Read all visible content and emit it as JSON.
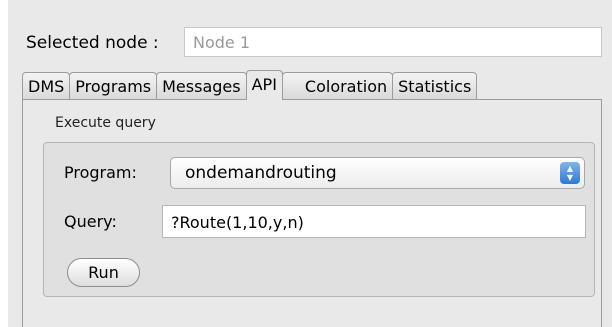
{
  "header": {
    "selected_node_label": "Selected node :",
    "selected_node_value": "Node 1"
  },
  "tabs": [
    {
      "label": "DMS",
      "active": false
    },
    {
      "label": "Programs",
      "active": false
    },
    {
      "label": "Messages",
      "active": false
    },
    {
      "label": "API",
      "active": true
    },
    {
      "label": "Coloration",
      "active": false
    },
    {
      "label": "Statistics",
      "active": false
    }
  ],
  "query_group": {
    "title": "Execute query",
    "program_label": "Program:",
    "program_value": "ondemandrouting",
    "query_label": "Query:",
    "query_value": "?Route(1,10,y,n)",
    "run_label": "Run"
  },
  "colors": {
    "select_arrow_accent": "#3a83db",
    "panel_background": "#e9e9e9"
  }
}
